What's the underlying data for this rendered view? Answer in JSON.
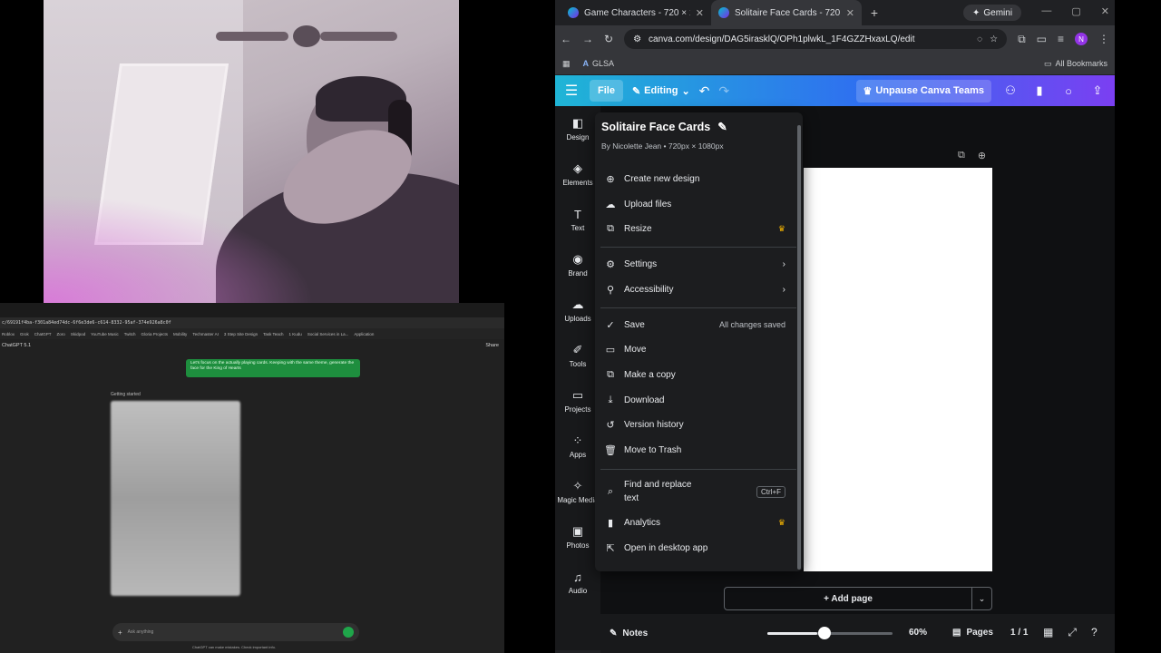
{
  "chat": {
    "url": "c/69191f4ba-f301a84ed74dc-6f6e3de6-c614-8332-95af-374e926a8c0f",
    "bookmarks": [
      "Roblox",
      "Grok",
      "ChatGPT",
      "Zoro",
      "Skidpod",
      "YouTube Music",
      "Twitch",
      "Gloria Projects",
      "Mobility",
      "Techmaster AI",
      "3 Step Site Design",
      "Task Teach",
      "1 Kudu",
      "Social Services in La...",
      "Application"
    ],
    "model_label": "ChatGPT 5.1",
    "share_label": "Share",
    "user_message": "Let's focus on the actually playing cards. Keeping with the same theme, generate the face for the King of Hearts",
    "getting_started": "Getting started",
    "input_placeholder": "Ask anything",
    "disclaimer": "ChatGPT can make mistakes. Check important info."
  },
  "browser": {
    "tabs": [
      {
        "title": "Game Characters - 720 × 1080px"
      },
      {
        "title": "Solitaire Face Cards - 720 × 1080px"
      }
    ],
    "gemini_label": "Gemini",
    "url": "canva.com/design/DAG5irasklQ/OPh1plwkL_1F4GZZHxaxLQ/edit",
    "profile_initial": "N",
    "bookmark_glsa": "GLSA",
    "all_bookmarks": "All Bookmarks"
  },
  "toolbar": {
    "file_label": "File",
    "editing_label": "Editing",
    "unpause_label": "Unpause Canva Teams"
  },
  "sidebar": {
    "items": [
      {
        "label": "Design",
        "icon": "design-icon"
      },
      {
        "label": "Elements",
        "icon": "elements-icon"
      },
      {
        "label": "Text",
        "icon": "text-icon"
      },
      {
        "label": "Brand",
        "icon": "brand-icon"
      },
      {
        "label": "Uploads",
        "icon": "uploads-icon"
      },
      {
        "label": "Tools",
        "icon": "tools-icon"
      },
      {
        "label": "Projects",
        "icon": "projects-icon"
      },
      {
        "label": "Apps",
        "icon": "apps-icon"
      },
      {
        "label": "Magic Media",
        "icon": "magic-media-icon"
      },
      {
        "label": "Photos",
        "icon": "photos-icon"
      },
      {
        "label": "Audio",
        "icon": "audio-icon"
      }
    ]
  },
  "filemenu": {
    "title": "Solitaire Face Cards",
    "subtitle": "By Nicolette Jean • 720px × 1080px",
    "items": {
      "create": "Create new design",
      "upload": "Upload files",
      "resize": "Resize",
      "settings": "Settings",
      "accessibility": "Accessibility",
      "save": "Save",
      "save_status": "All changes saved",
      "move": "Move",
      "copy": "Make a copy",
      "download": "Download",
      "version": "Version history",
      "trash": "Move to Trash",
      "find": "Find and replace text",
      "find_shortcut": "Ctrl+F",
      "analytics": "Analytics",
      "desktop": "Open in desktop app"
    }
  },
  "canvas": {
    "add_page": "+ Add page"
  },
  "footer": {
    "notes": "Notes",
    "zoom": "60%",
    "pages": "Pages",
    "page_count": "1 / 1"
  }
}
